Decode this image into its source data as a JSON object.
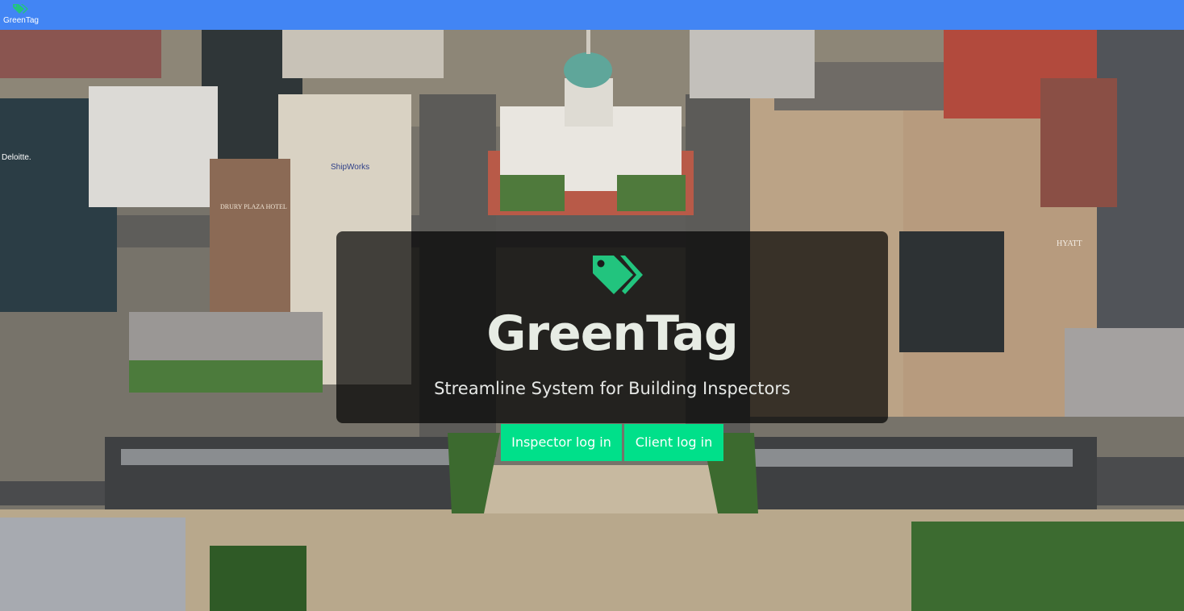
{
  "navbar": {
    "brand_label": "GreenTag",
    "color": "#4285f4"
  },
  "hero": {
    "title": "GreenTag",
    "subtitle": "Streamline System for Building Inspectors",
    "icon": "tags-icon",
    "icon_color": "#22c47e"
  },
  "actions": {
    "inspector_login": "Inspector log in",
    "client_login": "Client log in",
    "button_color": "#00e08a"
  },
  "background": {
    "signs": {
      "deloitte": "Deloitte.",
      "shipworks": "ShipWorks",
      "drury": "DRURY PLAZA HOTEL",
      "hyatt": "HYATT"
    }
  }
}
